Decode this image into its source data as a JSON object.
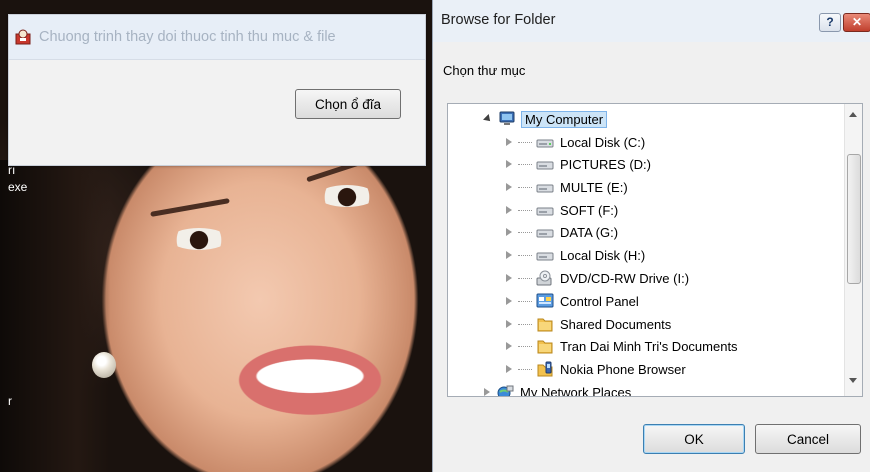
{
  "desktop": {
    "text_1": "rı",
    "text_2": "exe",
    "text_3": "r"
  },
  "app_window": {
    "title": "Chuong trinh thay doi thuoc tinh thu muc & file",
    "choose_drive_label": "Chọn ổ đĩa"
  },
  "dialog": {
    "title": "Browse for Folder",
    "help_label": "?",
    "close_label": "✕",
    "instruction": "Chọn thư mục",
    "tree": {
      "root": {
        "label": "My Computer",
        "icon": "computer-icon",
        "selected": true
      },
      "items": [
        {
          "label": "Local Disk (C:)",
          "icon": "drive-icon"
        },
        {
          "label": "PICTURES (D:)",
          "icon": "drive-icon"
        },
        {
          "label": "MULTE (E:)",
          "icon": "drive-icon"
        },
        {
          "label": "SOFT (F:)",
          "icon": "drive-icon"
        },
        {
          "label": "DATA (G:)",
          "icon": "drive-icon"
        },
        {
          "label": "Local Disk (H:)",
          "icon": "drive-icon"
        },
        {
          "label": "DVD/CD-RW Drive (I:)",
          "icon": "cd-drive-icon"
        },
        {
          "label": "Control Panel",
          "icon": "control-panel-icon"
        },
        {
          "label": "Shared Documents",
          "icon": "folder-icon"
        },
        {
          "label": "Tran Dai Minh Tri's Documents",
          "icon": "folder-icon"
        },
        {
          "label": "Nokia Phone Browser",
          "icon": "phone-browser-icon"
        }
      ],
      "last": {
        "label": "My Network Places",
        "icon": "network-icon"
      }
    },
    "ok_label": "OK",
    "cancel_label": "Cancel"
  }
}
